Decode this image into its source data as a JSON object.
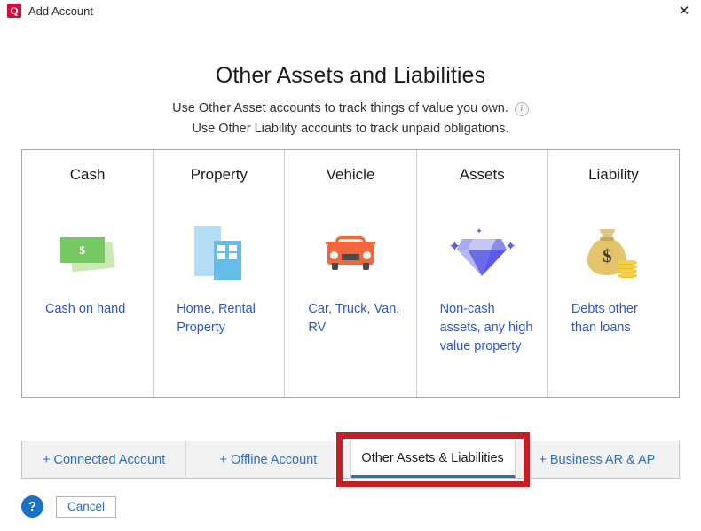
{
  "window": {
    "logo_label": "Q",
    "title": "Add Account",
    "close_icon": "close-icon"
  },
  "header": {
    "title": "Other Assets and Liabilities",
    "subtitle_line_1": "Use Other Asset accounts to track things of value you own.",
    "subtitle_line_2": "Use Other Liability accounts to track unpaid obligations.",
    "info_icon_glyph": "i"
  },
  "cards": [
    {
      "title": "Cash",
      "description": "Cash on hand",
      "icon": "cash-bills-icon",
      "icon_symbol": "$",
      "colors": {
        "primary": "#76c863",
        "secondary": "#c9eab0"
      }
    },
    {
      "title": "Property",
      "description": "Home, Rental Property",
      "icon": "buildings-icon",
      "colors": {
        "primary": "#65bce8",
        "secondary": "#b3ddf7"
      }
    },
    {
      "title": "Vehicle",
      "description": "Car, Truck, Van, RV",
      "icon": "car-icon",
      "colors": {
        "primary": "#f2663c",
        "secondary": "#494949"
      }
    },
    {
      "title": "Assets",
      "description": "Non-cash assets, any high value property",
      "icon": "diamond-gem-icon",
      "sparkle_glyph": "✦",
      "colors": {
        "primary": "#6b6bea",
        "secondary": "#c5c7f7"
      }
    },
    {
      "title": "Liability",
      "description": "Debts other than loans",
      "icon": "money-bag-icon",
      "icon_symbol": "$",
      "colors": {
        "primary": "#e3c46d",
        "secondary": "#f5cf3f"
      }
    }
  ],
  "tabs": [
    {
      "label": "+ Connected Account",
      "active": false
    },
    {
      "label": "+ Offline Account",
      "active": false
    },
    {
      "label": "Other Assets & Liabilities",
      "active": true
    },
    {
      "label": "+ Business AR & AP",
      "active": false
    }
  ],
  "footer": {
    "help_glyph": "?",
    "cancel_label": "Cancel"
  },
  "theme": {
    "link_blue": "#2c55d4",
    "tab_blue": "#2c6fc4",
    "active_underline": "#2d6fba",
    "annotation_red": "#c32025",
    "brand_red": "#d0103a"
  }
}
